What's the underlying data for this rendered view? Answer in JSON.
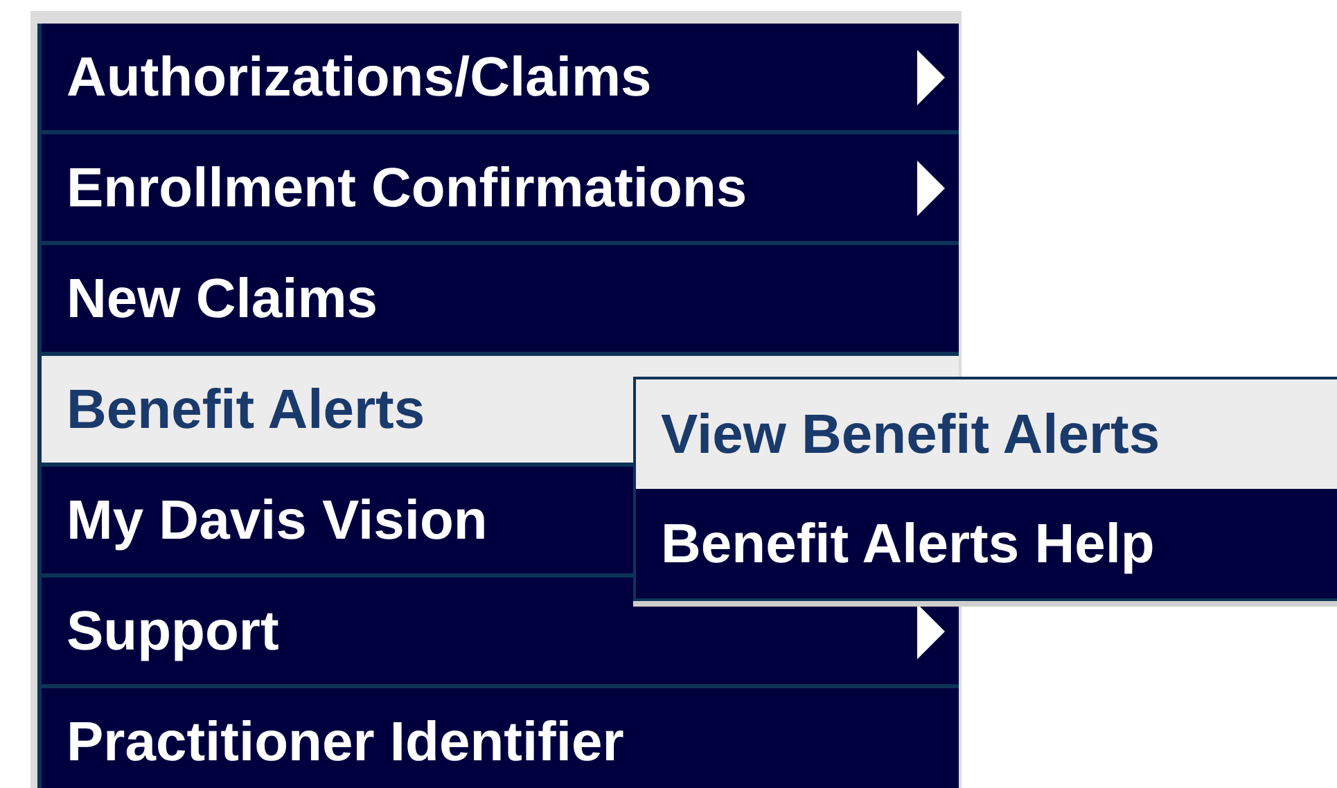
{
  "menu": {
    "items": [
      {
        "label": "Authorizations/Claims",
        "arrow": true,
        "selected": false
      },
      {
        "label": "Enrollment Confirmations",
        "arrow": true,
        "selected": false
      },
      {
        "label": "New Claims",
        "arrow": false,
        "selected": false
      },
      {
        "label": "Benefit Alerts",
        "arrow": false,
        "selected": true
      },
      {
        "label": "My Davis Vision",
        "arrow": false,
        "selected": false
      },
      {
        "label": "Support",
        "arrow": true,
        "selected": false
      },
      {
        "label": "Practitioner Identifier",
        "arrow": false,
        "selected": false
      }
    ]
  },
  "submenu": {
    "items": [
      {
        "label": "View Benefit Alerts",
        "selected": true
      },
      {
        "label": "Benefit Alerts Help",
        "selected": false
      }
    ]
  }
}
